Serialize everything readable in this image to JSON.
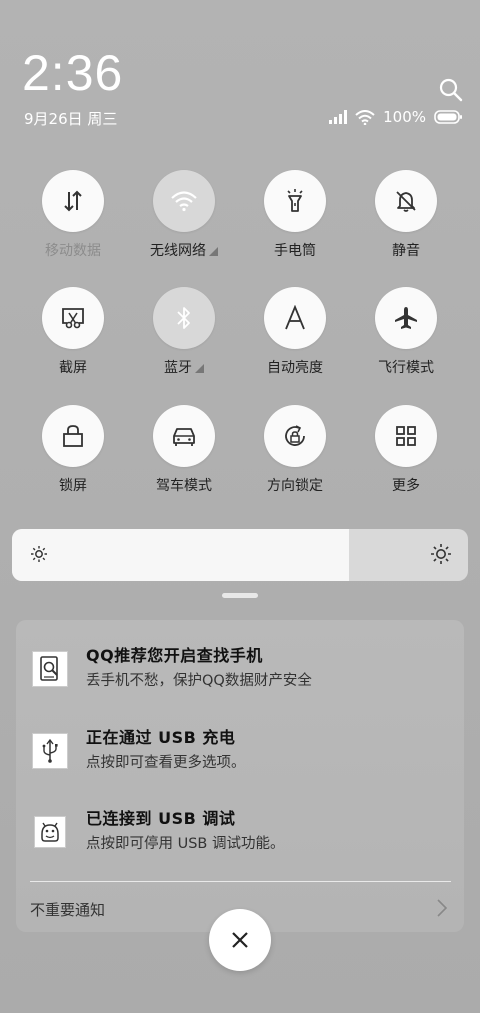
{
  "status": {
    "time": "2:36",
    "date": "9月26日 周三",
    "battery": "100%",
    "battery_level": 1.0
  },
  "toggles": [
    {
      "label": "移动数据",
      "icon": "data-arrows-icon",
      "state": "dim"
    },
    {
      "label": "无线网络",
      "icon": "wifi-icon",
      "state": "off",
      "expandable": true
    },
    {
      "label": "手电筒",
      "icon": "flashlight-icon",
      "state": "on"
    },
    {
      "label": "静音",
      "icon": "bell-mute-icon",
      "state": "on"
    },
    {
      "label": "截屏",
      "icon": "screenshot-scissors-icon",
      "state": "on"
    },
    {
      "label": "蓝牙",
      "icon": "bluetooth-icon",
      "state": "off",
      "expandable": true
    },
    {
      "label": "自动亮度",
      "icon": "auto-brightness-icon",
      "state": "on"
    },
    {
      "label": "飞行模式",
      "icon": "airplane-icon",
      "state": "on"
    },
    {
      "label": "锁屏",
      "icon": "lock-icon",
      "state": "on"
    },
    {
      "label": "驾车模式",
      "icon": "car-icon",
      "state": "on"
    },
    {
      "label": "方向锁定",
      "icon": "rotation-lock-icon",
      "state": "on"
    },
    {
      "label": "更多",
      "icon": "grid-more-icon",
      "state": "on"
    }
  ],
  "brightness": {
    "level": 0.74
  },
  "notifications": [
    {
      "title": "QQ推荐您开启查找手机",
      "desc": "丢手机不愁，保护QQ数据财产安全",
      "icon": "qq-find-phone-icon"
    },
    {
      "title": "正在通过  USB  充电",
      "desc": "点按即可查看更多选项。",
      "icon": "usb-icon"
    },
    {
      "title": "已连接到  USB  调试",
      "desc": "点按即可停用 USB 调试功能。",
      "icon": "android-debug-icon"
    }
  ],
  "unimportant_label": "不重要通知",
  "colors": {
    "tile_on": "#fafafa",
    "tile_off": "#d8d8d8",
    "background": "#b0b0b0"
  }
}
